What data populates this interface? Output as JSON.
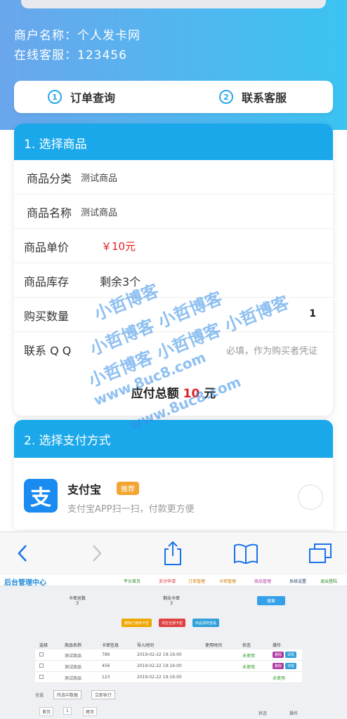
{
  "header": {
    "merchant_name": "商户名称：个人发卡网",
    "service": "在线客服：123456"
  },
  "tabs": [
    {
      "num": "1",
      "label": "订单查询"
    },
    {
      "num": "2",
      "label": "联系客服"
    }
  ],
  "section1": {
    "title": "1. 选择商品",
    "category_label": "商品分类",
    "category_value": "测试商品",
    "name_label": "商品名称",
    "name_value": "测试商品",
    "price_label": "商品单价",
    "price_value": "￥10元",
    "stock_label": "商品库存",
    "stock_value": "剩余3个",
    "qty_label": "购买数量",
    "qty_value": "1",
    "qq_label": "联系 Q Q",
    "qq_placeholder": "必填，作为购买者凭证",
    "total_label": "应付总额",
    "total_value": "10",
    "total_unit": "元"
  },
  "section2": {
    "title": "2. 选择支付方式",
    "alipay_logo": "支",
    "alipay_name": "支付宝",
    "alipay_badge": "推荐",
    "alipay_desc": "支付宝APP扫一扫，付款更方便"
  },
  "browser": {
    "icons": [
      "back-icon",
      "forward-icon",
      "share-icon",
      "bookmarks-icon",
      "tabs-icon"
    ]
  },
  "admin": {
    "title": "后台管理中心",
    "nav": [
      "平台首页",
      "支付申请",
      "订单管理",
      "卡密管理",
      "商品管理",
      "系统设置",
      "退出登陆"
    ],
    "stat1_label": "卡密总数",
    "stat1_value": "3",
    "stat2_label": "剩余卡密",
    "stat2_value": "3",
    "search_btn": "搜索",
    "actions": [
      "删除已使用卡密",
      "清空全部卡密",
      "商品规则查看"
    ],
    "headers": [
      "选择",
      "商品名称",
      "卡密信息",
      "导入时间",
      "使用时间",
      "状态",
      "操作"
    ],
    "rows": [
      {
        "name": "测试商品",
        "card": "789",
        "time": "2019-02-22 19:16:00",
        "status": "未使用"
      },
      {
        "name": "测试商品",
        "card": "456",
        "time": "2019-02-22 19:16:00",
        "status": "未使用"
      },
      {
        "name": "测试商品",
        "card": "123",
        "time": "2019-02-22 19:16:00",
        "status": "未使用"
      }
    ],
    "row_actions": [
      "删除",
      "详情"
    ],
    "select_all": "全选",
    "batch_select": "所选中数据",
    "execute": "立即执行",
    "pager": [
      "首页",
      "1",
      "尾页"
    ],
    "footer_cols": [
      "状态",
      "操作"
    ]
  },
  "watermark": [
    "小哲博客",
    "小哲博客 小哲博客",
    "小哲博客 小哲博客 小哲博客",
    "哲博客 小哲博客 www.8uc8.com",
    "www.8uc8.com",
    "www.8uc8.com",
    "www.8uc8.com"
  ]
}
